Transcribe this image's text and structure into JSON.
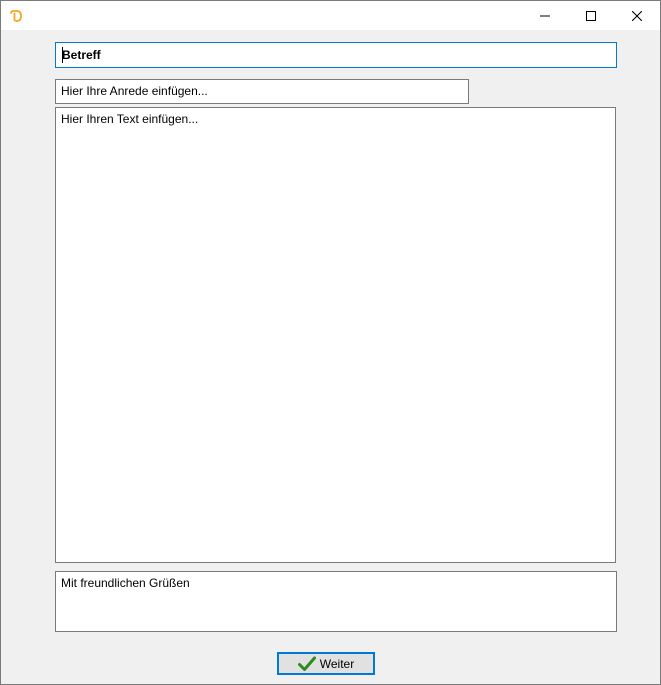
{
  "titlebar": {
    "app_icon": "app-logo-icon",
    "minimize_icon": "minimize-icon",
    "maximize_icon": "maximize-icon",
    "close_icon": "close-icon"
  },
  "form": {
    "subject_value": "Betreff",
    "salutation_placeholder": "Hier Ihre Anrede einfügen...",
    "body_placeholder": "Hier Ihren Text einfügen...",
    "closing_value": "Mit freundlichen Grüßen"
  },
  "footer": {
    "next_button_label": "Weiter",
    "next_button_icon": "checkmark-icon"
  },
  "colors": {
    "window_background": "#f0f0f0",
    "focus_accent": "#0078d7",
    "checkmark_green": "#2e8b1f",
    "app_icon_orange": "#f5a623"
  }
}
